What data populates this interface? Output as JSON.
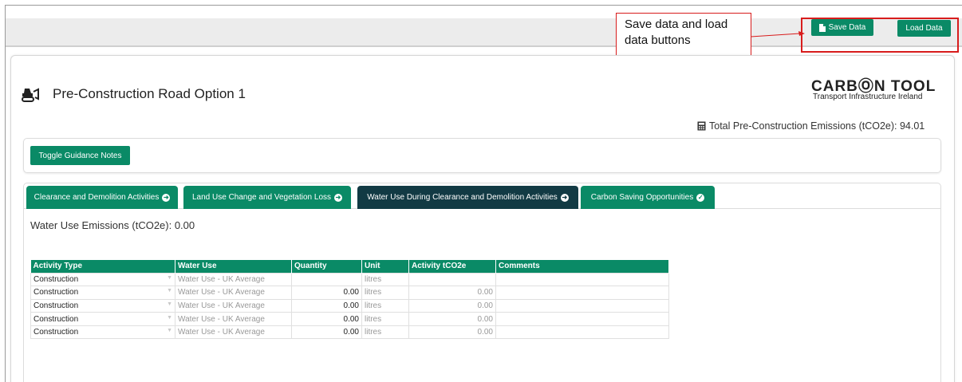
{
  "toolbar": {
    "save_label": "Save Data",
    "load_label": "Load Data"
  },
  "annotation": {
    "callout_text": "Save data and load data buttons"
  },
  "header": {
    "title": "Pre-Construction Road Option 1",
    "logo_main": "CARBⓄN TOOL",
    "logo_sub": "Transport Infrastructure Ireland",
    "total_emissions": "Total Pre-Construction Emissions (tCO2e): 94.01"
  },
  "guidance": {
    "toggle_label": "Toggle Guidance Notes"
  },
  "tabs": [
    {
      "label": "Clearance and Demolition Activities",
      "icon": "arrow-circle-right-icon"
    },
    {
      "label": "Land Use Change and Vegetation Loss",
      "icon": "arrow-circle-right-icon"
    },
    {
      "label": "Water Use During Clearance and Demolition Activities",
      "icon": "arrow-circle-right-icon"
    },
    {
      "label": "Carbon Saving Opportunities",
      "icon": "check-circle-icon"
    }
  ],
  "water_emissions": "Water Use Emissions (tCO2e): 0.00",
  "table": {
    "headers": [
      "Activity Type",
      "Water Use",
      "Quantity",
      "Unit",
      "Activity tCO2e",
      "Comments"
    ],
    "rows": [
      [
        "Construction",
        "Water Use - UK Average",
        "",
        "litres",
        "",
        ""
      ],
      [
        "Construction",
        "Water Use - UK Average",
        "0.00",
        "litres",
        "0.00",
        ""
      ],
      [
        "Construction",
        "Water Use - UK Average",
        "0.00",
        "litres",
        "0.00",
        ""
      ],
      [
        "Construction",
        "Water Use - UK Average",
        "0.00",
        "litres",
        "0.00",
        ""
      ],
      [
        "Construction",
        "Water Use - UK Average",
        "0.00",
        "litres",
        "0.00",
        ""
      ]
    ]
  },
  "colors": {
    "accent": "#0a8a66",
    "active_tab": "#123a44",
    "annotation": "#d81c1c"
  }
}
